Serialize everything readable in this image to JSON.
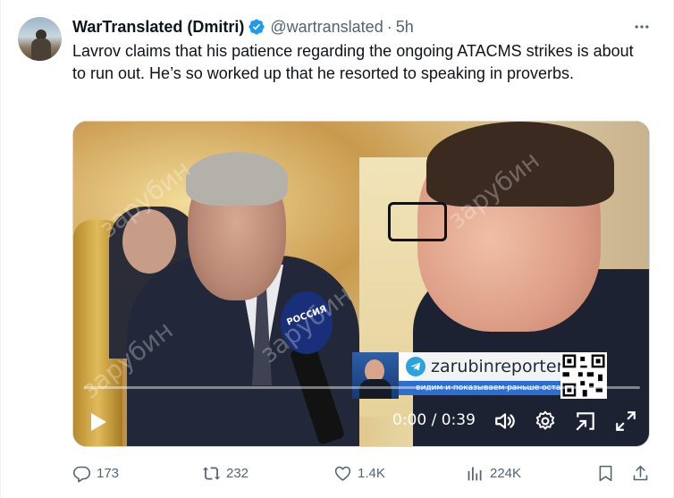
{
  "author": {
    "name": "WarTranslated (Dmitri)",
    "handle": "@wartranslated",
    "separator": "·",
    "time": "5h"
  },
  "tweet_text": "Lavrov claims that his patience regarding the ongoing ATACMS strikes is about to run out. He’s so worked up that he resorted to speaking in proverbs.",
  "video": {
    "timecode": "0:00 / 0:39",
    "progress": 0,
    "overlay": {
      "channel": "zarubinreporter",
      "tagline": "видим и показываем раньше остальных",
      "mic_label": "РОССИЯ",
      "watermark": "зарубин"
    }
  },
  "actions": {
    "replies": "173",
    "reposts": "232",
    "likes": "1.4K",
    "views": "224K"
  },
  "colors": {
    "text": "#0f1419",
    "secondary": "#536471",
    "verified": "#1d9bf0"
  }
}
